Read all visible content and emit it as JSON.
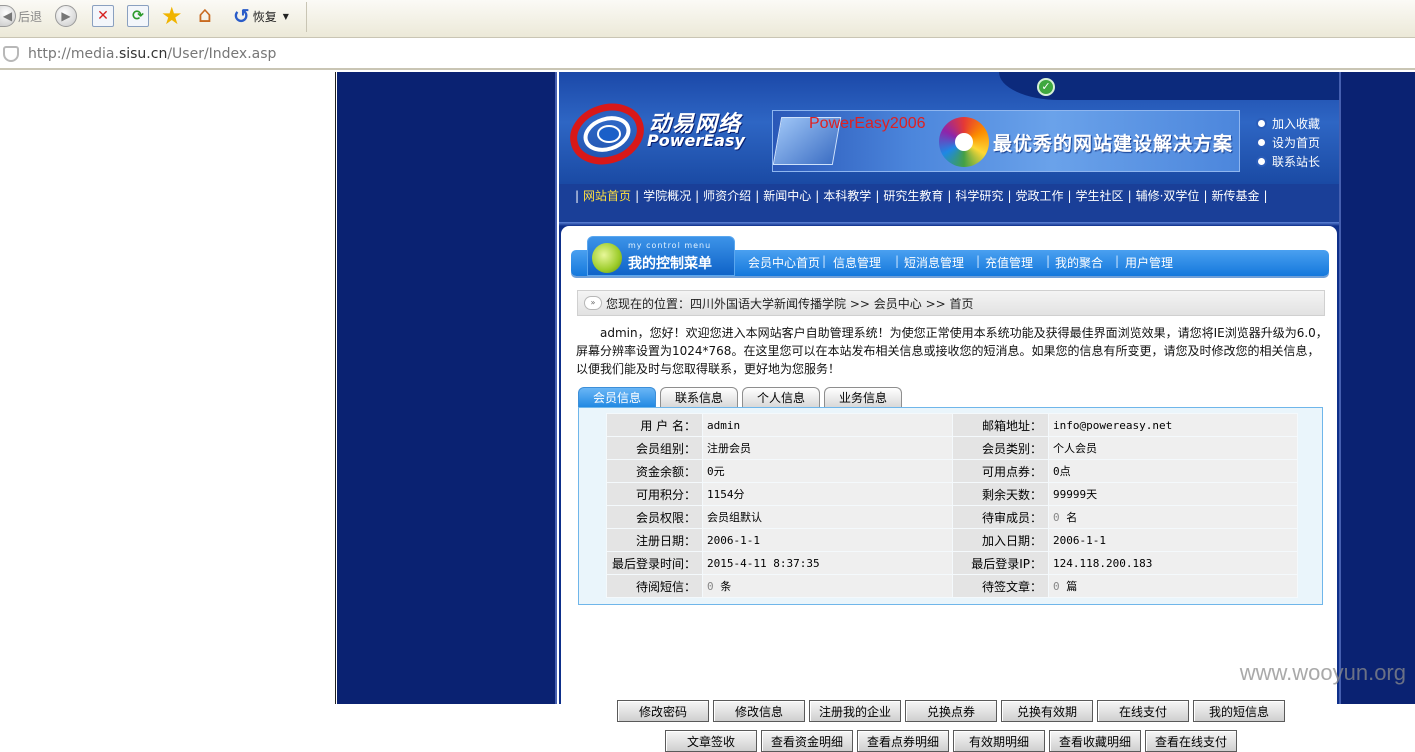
{
  "browser": {
    "back_label": "后退",
    "restore_label": "恢复",
    "url_prefix": "http://media.",
    "url_host": "sisu.cn",
    "url_path": "/User/Index.asp"
  },
  "header": {
    "logo_cn": "动易网络",
    "logo_en": "PowerEasy",
    "banner_product": "PowerEasy2006",
    "banner_slogan": "最优秀的网站建设解决方案",
    "quick_links": [
      "加入收藏",
      "设为首页",
      "联系站长"
    ]
  },
  "nav": {
    "items": [
      "网站首页",
      "学院概况",
      "师资介绍",
      "新闻中心",
      "本科教学",
      "研究生教育",
      "科学研究",
      "党政工作",
      "学生社区",
      "辅修·双学位",
      "新传基金"
    ],
    "current_index": 0
  },
  "control_menu": {
    "badge_small": "my control menu",
    "badge_title": "我的控制菜单",
    "items": [
      "会员中心首页",
      "信息管理",
      "短消息管理",
      "充值管理",
      "我的聚合",
      "用户管理"
    ]
  },
  "breadcrumb": {
    "prefix": "您现在的位置：",
    "path": "四川外国语大学新闻传播学院 >> 会员中心 >> 首页"
  },
  "welcome_text": "admin，您好！欢迎您进入本网站客户自助管理系统！为使您正常使用本系统功能及获得最佳界面浏览效果，请您将IE浏览器升级为6.0，屏幕分辨率设置为1024*768。在这里您可以在本站发布相关信息或接收您的短消息。如果您的信息有所变更，请您及时修改您的相关信息，以便我们能及时与您取得联系，更好地为您服务！",
  "tabs": [
    "会员信息",
    "联系信息",
    "个人信息",
    "业务信息"
  ],
  "member_info": {
    "rows": [
      [
        "用 户 名：",
        "admin",
        "邮箱地址：",
        "info@powereasy.net"
      ],
      [
        "会员组别：",
        "注册会员",
        "会员类别：",
        "个人会员"
      ],
      [
        "资金余额：",
        "0元",
        "可用点券：",
        "0点"
      ],
      [
        "可用积分：",
        "1154分",
        "剩余天数：",
        "99999天"
      ],
      [
        "会员权限：",
        "会员组默认",
        "待审成员：",
        "0 名"
      ],
      [
        "注册日期：",
        "2006-1-1",
        "加入日期：",
        "2006-1-1"
      ],
      [
        "最后登录时间：",
        "2015-4-11 8:37:35",
        "最后登录IP：",
        "124.118.200.183"
      ],
      [
        "待阅短信：",
        "0 条",
        "待签文章：",
        "0 篇"
      ]
    ]
  },
  "buttons_row1": [
    "修改密码",
    "修改信息",
    "注册我的企业",
    "兑换点券",
    "兑换有效期",
    "在线支付",
    "我的短信息"
  ],
  "buttons_row2": [
    "文章签收",
    "查看资金明细",
    "查看点券明细",
    "有效期明细",
    "查看收藏明细",
    "查看在线支付"
  ],
  "watermark": "www.wooyun.org",
  "colors": {
    "site_bg": "#0e2f8a",
    "nav_current": "#ffe040",
    "menu_blue": "#1478dc",
    "active_tab": "#1a84e0"
  }
}
